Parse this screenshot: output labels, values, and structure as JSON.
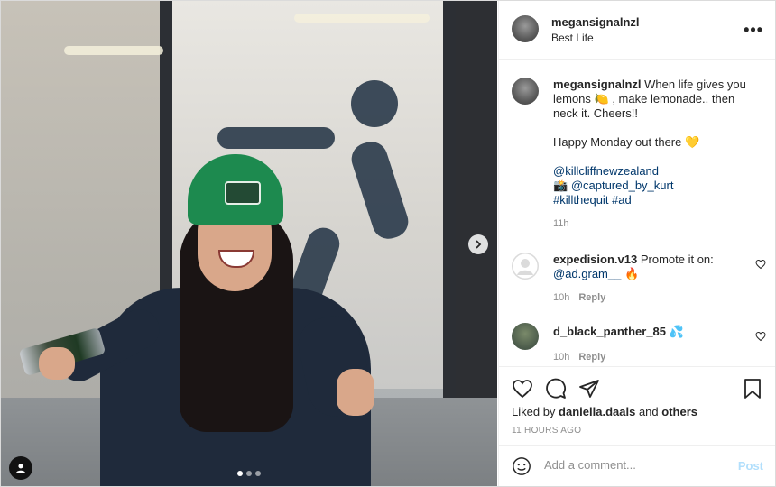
{
  "post": {
    "author": "megansignalnzl",
    "location": "Best Life",
    "more_icon": "more-options-icon",
    "carousel": {
      "slide_count": 3,
      "active_index": 0
    }
  },
  "caption": {
    "author": "megansignalnzl",
    "line1": "When life gives you lemons 🍋 , make lemonade.. then neck it. Cheers!!",
    "line2": "Happy Monday out there 💛",
    "mention1": "@killcliffnewzealand",
    "line3_prefix": "📸",
    "mention2": "@captured_by_kurt",
    "hashtags": "#killthequit #ad",
    "time": "11h"
  },
  "comments": [
    {
      "author": "expedision.v13",
      "text_prefix": "Promote it on:",
      "mention": "@ad.gram__",
      "emoji": "🔥",
      "time": "10h",
      "reply_label": "Reply"
    },
    {
      "author": "d_black_panther_85",
      "emoji": "💦",
      "time": "10h",
      "reply_label": "Reply"
    }
  ],
  "likes": {
    "prefix": "Liked by",
    "user": "daniella.daals",
    "joiner": "and",
    "others": "others"
  },
  "posted_ago": "11 HOURS AGO",
  "comment_box": {
    "placeholder": "Add a comment...",
    "post_label": "Post"
  },
  "colors": {
    "link": "#00376b",
    "muted": "#8e8e8e",
    "post_disabled": "#b2dffc",
    "beanie": "#1d8a4f"
  }
}
